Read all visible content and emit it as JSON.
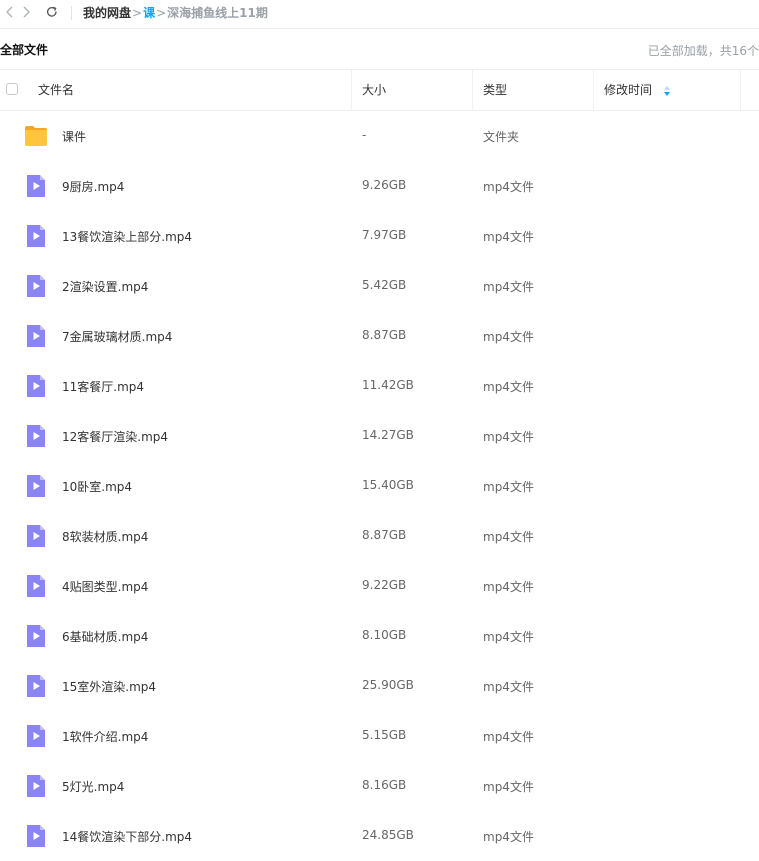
{
  "nav": {
    "breadcrumb": {
      "root": "我的网盘",
      "sep": ">",
      "folder": "课",
      "current": "深海捕鱼线上11期"
    }
  },
  "title": {
    "text": "全部文件",
    "status": "已全部加载，共16个"
  },
  "columns": {
    "name": "文件名",
    "size": "大小",
    "type": "类型",
    "modified": "修改时间"
  },
  "files": [
    {
      "name": "课件",
      "size": "-",
      "type": "文件夹",
      "icon": "folder-icon"
    },
    {
      "name": "9厨房.mp4",
      "size": "9.26GB",
      "type": "mp4文件",
      "icon": "video-file-icon"
    },
    {
      "name": "13餐饮渲染上部分.mp4",
      "size": "7.97GB",
      "type": "mp4文件",
      "icon": "video-file-icon"
    },
    {
      "name": "2渲染设置.mp4",
      "size": "5.42GB",
      "type": "mp4文件",
      "icon": "video-file-icon"
    },
    {
      "name": "7金属玻璃材质.mp4",
      "size": "8.87GB",
      "type": "mp4文件",
      "icon": "video-file-icon"
    },
    {
      "name": "11客餐厅.mp4",
      "size": "11.42GB",
      "type": "mp4文件",
      "icon": "video-file-icon"
    },
    {
      "name": "12客餐厅渲染.mp4",
      "size": "14.27GB",
      "type": "mp4文件",
      "icon": "video-file-icon"
    },
    {
      "name": "10卧室.mp4",
      "size": "15.40GB",
      "type": "mp4文件",
      "icon": "video-file-icon"
    },
    {
      "name": "8软装材质.mp4",
      "size": "8.87GB",
      "type": "mp4文件",
      "icon": "video-file-icon"
    },
    {
      "name": "4贴图类型.mp4",
      "size": "9.22GB",
      "type": "mp4文件",
      "icon": "video-file-icon"
    },
    {
      "name": "6基础材质.mp4",
      "size": "8.10GB",
      "type": "mp4文件",
      "icon": "video-file-icon"
    },
    {
      "name": "15室外渲染.mp4",
      "size": "25.90GB",
      "type": "mp4文件",
      "icon": "video-file-icon"
    },
    {
      "name": "1软件介绍.mp4",
      "size": "5.15GB",
      "type": "mp4文件",
      "icon": "video-file-icon"
    },
    {
      "name": "5灯光.mp4",
      "size": "8.16GB",
      "type": "mp4文件",
      "icon": "video-file-icon"
    },
    {
      "name": "14餐饮渲染下部分.mp4",
      "size": "24.85GB",
      "type": "mp4文件",
      "icon": "video-file-icon"
    }
  ],
  "colors": {
    "accent": "#06a7ff",
    "video_icon": "#8b84f4",
    "folder_icon": "#ffc53d",
    "muted": "#9aa0a8"
  }
}
